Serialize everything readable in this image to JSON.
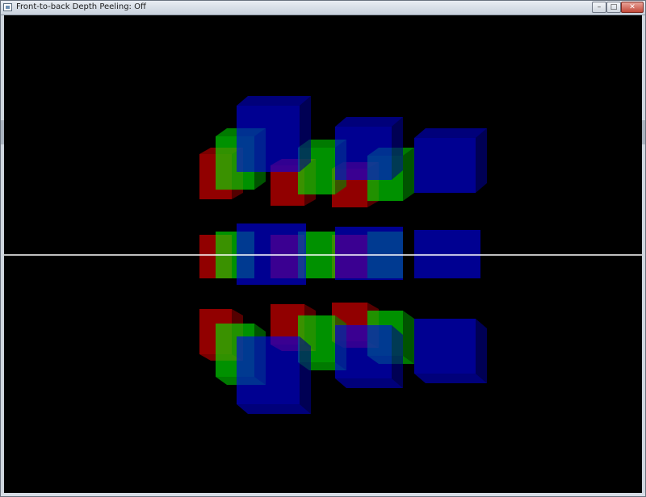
{
  "window": {
    "title": "Front-to-back Depth Peeling: Off",
    "icon": "app-window-icon",
    "controls": {
      "minimize": "–",
      "maximize": "□",
      "close": "✕"
    }
  },
  "scene": {
    "background": "#000000",
    "colors": {
      "red": "#ff0000",
      "green": "#00ff00",
      "blue": "#0000ff"
    },
    "horizon_line_color": "#ffffff",
    "cube_opacity": 0.6
  }
}
